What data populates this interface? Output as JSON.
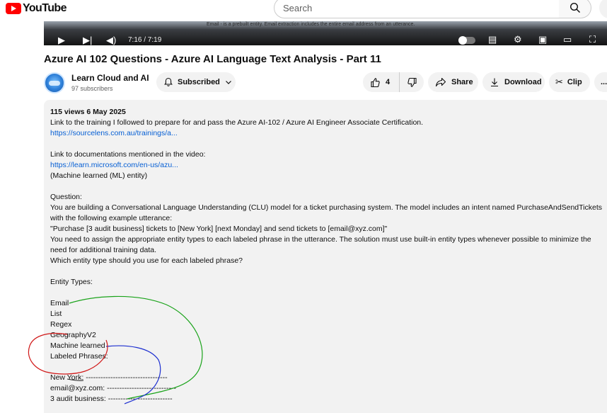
{
  "masthead": {
    "logo_text": "YouTube",
    "search_placeholder": "Search"
  },
  "player": {
    "time": "7:16 / 7:19",
    "frame_text": "Email - is a prebuilt entity. Email extraction includes the entire email address from an utterance."
  },
  "video": {
    "title": "Azure AI 102 Questions - Azure AI Language Text Analysis - Part 11"
  },
  "channel": {
    "name": "Learn Cloud and AI",
    "subscribers": "97 subscribers",
    "subscribed_label": "Subscribed"
  },
  "actions": {
    "likes": "4",
    "share": "Share",
    "download": "Download",
    "clip": "Clip",
    "more": "..."
  },
  "description": {
    "meta": "115 views  6 May 2025",
    "lines": [
      "Link to the training I followed to prepare for and pass the Azure AI-102 / Azure AI Engineer Associate Certification.",
      "https://sourcelens.com.au/trainings/a...",
      "Link to documentations mentioned in the video:",
      "https://learn.microsoft.com/en-us/azu...",
      "(Machine learned (ML) entity)",
      "Question:",
      "You are building a Conversational  Language Understanding (CLU) model for a ticket purchasing system. The model includes an intent named PurchaseAndSendTickets",
      "with the following example utterance:",
      "\"Purchase [3 audit business] tickets to [New York] [next Monday] and send tickets to [email@xyz.com]\"",
      "You need to assign the appropriate entity types to each labeled phrase in the utterance. The solution must use built-in entity types whenever possible to minimize the",
      "need for additional training data.",
      "Which entity type should you use for each labeled phrase?",
      "Entity Types:",
      "Email",
      "List",
      "Regex",
      "GeographyV2",
      "Machine learned",
      "Labeled Phrases:",
      "New York: ---------------------------------",
      "email@xyz.com: ----------------------------",
      "3 audit business: --------------------------"
    ]
  },
  "colors": {
    "brand_red": "#ff0000",
    "link_blue": "#065fd4",
    "annotation_green": "#1aa31a",
    "annotation_blue": "#1d2fd0",
    "annotation_red": "#d01818"
  }
}
